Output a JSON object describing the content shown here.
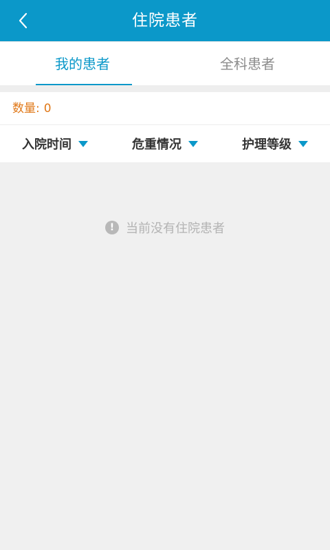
{
  "header": {
    "title": "住院患者",
    "back_icon": "chevron-left-icon"
  },
  "tabs": [
    {
      "label": "我的患者",
      "active": true
    },
    {
      "label": "全科患者",
      "active": false
    }
  ],
  "count": {
    "label": "数量",
    "separator": ":",
    "value": "0"
  },
  "filters": [
    {
      "label": "入院时间",
      "icon": "caret-down-icon"
    },
    {
      "label": "危重情况",
      "icon": "caret-down-icon"
    },
    {
      "label": "护理等级",
      "icon": "caret-down-icon"
    }
  ],
  "empty": {
    "icon": "exclamation-circle-icon",
    "icon_glyph": "!",
    "message": "当前没有住院患者"
  },
  "colors": {
    "accent": "#0b98c9",
    "count_text": "#e07818",
    "background": "#f0f0f0"
  }
}
